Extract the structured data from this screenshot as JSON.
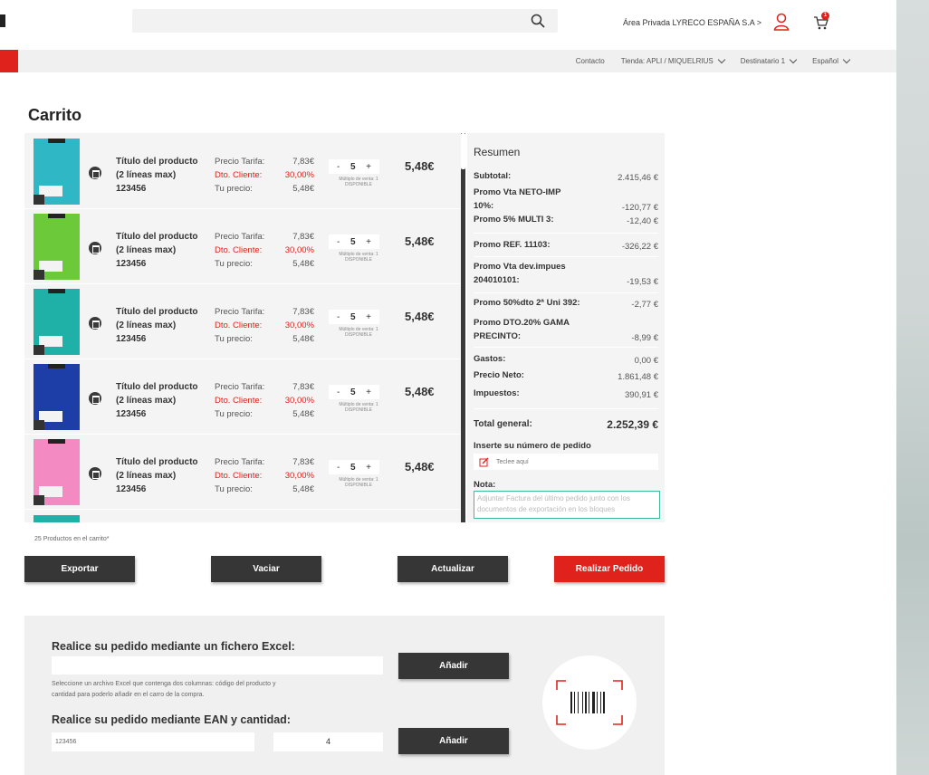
{
  "header": {
    "search": {
      "placeholder": "",
      "icon": "search-icon"
    },
    "private_area_label": "Área Privada LYRECO ESPAÑA S.A >",
    "cart_badge_count": "1",
    "accent_color": "#e0221c"
  },
  "subnav": {
    "contact": "Contacto",
    "store": "Tienda: APLI / MIQUELRIUS",
    "recipient": "Destinatario 1",
    "language": "Español"
  },
  "page": {
    "title": "Carrito"
  },
  "cart_items": [
    {
      "title_line1": "Título del producto",
      "title_line2": "(2 líneas max)",
      "code": "123456",
      "tariff_label": "Precio Tarifa:",
      "tariff_value": "7,83€",
      "discount_label": "Dto. Cliente:",
      "discount_value": "30,00%",
      "your_price_label": "Tu precio:",
      "your_price_value": "5,48€",
      "qty": "5",
      "qty_note_line1": "Múltiplo de venta: 1",
      "qty_note_line2": "DISPONIBLE",
      "total": "5,48€",
      "thumb_color": "#2fb7c6"
    },
    {
      "title_line1": "Título del producto",
      "title_line2": "(2 líneas max)",
      "code": "123456",
      "tariff_label": "Precio Tarifa:",
      "tariff_value": "7,83€",
      "discount_label": "Dto. Cliente:",
      "discount_value": "30,00%",
      "your_price_label": "Tu precio:",
      "your_price_value": "5,48€",
      "qty": "5",
      "qty_note_line1": "Múltiplo de venta: 1",
      "qty_note_line2": "DISPONIBLE",
      "total": "5,48€",
      "thumb_color": "#6cc93a"
    },
    {
      "title_line1": "Título del producto",
      "title_line2": "(2 líneas max)",
      "code": "123456",
      "tariff_label": "Precio Tarifa:",
      "tariff_value": "7,83€",
      "discount_label": "Dto. Cliente:",
      "discount_value": "30,00%",
      "your_price_label": "Tu precio:",
      "your_price_value": "5,48€",
      "qty": "5",
      "qty_note_line1": "Múltiplo de venta: 1",
      "qty_note_line2": "DISPONIBLE",
      "total": "5,48€",
      "thumb_color": "#1fb1a8"
    },
    {
      "title_line1": "Título del producto",
      "title_line2": "(2 líneas max)",
      "code": "123456",
      "tariff_label": "Precio Tarifa:",
      "tariff_value": "7,83€",
      "discount_label": "Dto. Cliente:",
      "discount_value": "30,00%",
      "your_price_label": "Tu precio:",
      "your_price_value": "5,48€",
      "qty": "5",
      "qty_note_line1": "Múltiplo de venta: 1",
      "qty_note_line2": "DISPONIBLE",
      "total": "5,48€",
      "thumb_color": "#1c3ea6"
    },
    {
      "title_line1": "Título del producto",
      "title_line2": "(2 líneas max)",
      "code": "123456",
      "tariff_label": "Precio Tarifa:",
      "tariff_value": "7,83€",
      "discount_label": "Dto. Cliente:",
      "discount_value": "30,00%",
      "your_price_label": "Tu precio:",
      "your_price_value": "5,48€",
      "qty": "5",
      "qty_note_line1": "Múltiplo de venta: 1",
      "qty_note_line2": "DISPONIBLE",
      "total": "5,48€",
      "thumb_color": "#f48ac2"
    }
  ],
  "summary": {
    "title": "Resumen",
    "rows": [
      {
        "label": "Subtotal:",
        "value": "2.415,46 €"
      },
      {
        "label": "Promo Vta NETO-IMP",
        "label2": "10%:",
        "value": "-120,77 €"
      },
      {
        "label": "Promo 5% MULTI 3:",
        "value": "-12,40 €"
      },
      {
        "label": "Promo REF. 11103:",
        "value": "-326,22 €"
      },
      {
        "label": "Promo Vta  dev.impues",
        "label2": "204010101:",
        "value": "-19,53 €"
      },
      {
        "label": "Promo 50%dto 2ª Uni 392:",
        "value": "-2,77 €"
      },
      {
        "label": "Promo DTO.20% GAMA",
        "label2": "PRECINTO:",
        "value": "-8,99 €"
      },
      {
        "label": "Gastos:",
        "value": "0,00 €"
      },
      {
        "label": "Precio Neto:",
        "value": "1.861,48 €"
      },
      {
        "label": "Impuestos:",
        "value": "390,91 €"
      }
    ],
    "total_label": "Total general:",
    "total_value": "2.252,39 €",
    "order_number_label": "Inserte su número de pedido",
    "order_number_placeholder": "Teclee aquí",
    "note_label": "Nota:",
    "note_placeholder": "Adjuntar Factura del último pedido junto con los documentos de exportación en los bloques"
  },
  "cart_count_text": "25 Productos en el carrito*",
  "actions": {
    "export": "Exportar",
    "empty": "Vaciar",
    "update": "Actualizar",
    "place_order": "Realizar Pedido"
  },
  "excel_panel": {
    "excel_heading": "Realice su pedido mediante un fichero Excel:",
    "excel_add": "Añadir",
    "excel_help_line1": "Seleccione un archivo Excel que contenga dos columnas: código del producto y",
    "excel_help_line2": "cantidad para poderlo añadir en el carro de la compra.",
    "ean_heading": "Realice su pedido mediante EAN y cantidad:",
    "ean_value": "123456",
    "qty_value": "4",
    "ean_add": "Añadir"
  }
}
